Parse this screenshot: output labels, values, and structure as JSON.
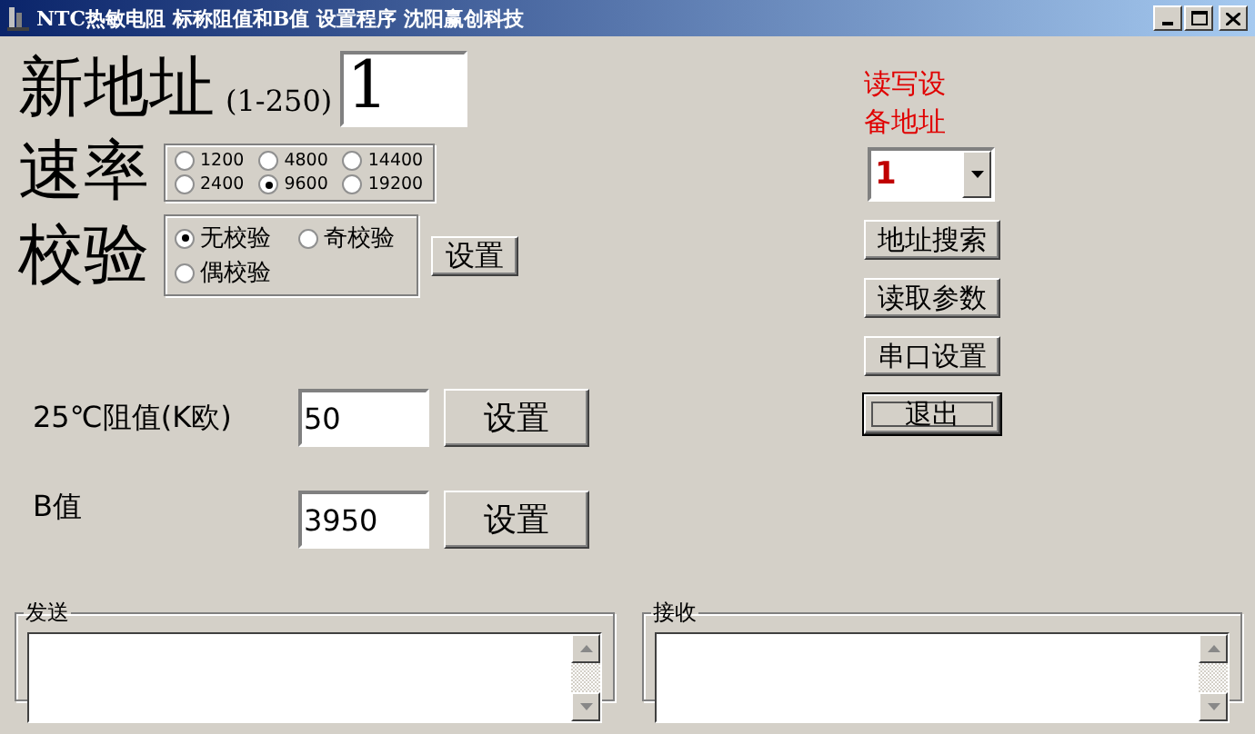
{
  "window": {
    "title": "NTC热敏电阻 标称阻值和B值 设置程序 沈阳赢创科技"
  },
  "address": {
    "label": "新地址",
    "range": "(1-250)",
    "value": "1"
  },
  "baud_rate": {
    "label": "速率",
    "options": [
      {
        "label": "1200",
        "selected": false
      },
      {
        "label": "4800",
        "selected": false
      },
      {
        "label": "14400",
        "selected": false
      },
      {
        "label": "2400",
        "selected": false
      },
      {
        "label": "9600",
        "selected": true
      },
      {
        "label": "19200",
        "selected": false
      }
    ]
  },
  "parity": {
    "label": "校验",
    "options": [
      {
        "label": "无校验",
        "selected": true
      },
      {
        "label": "奇校验",
        "selected": false
      },
      {
        "label": "偶校验",
        "selected": false
      }
    ],
    "button": "设置"
  },
  "device_address": {
    "label": "读写设备地址",
    "value": "1"
  },
  "side_buttons": [
    {
      "label": "地址搜索",
      "focused": false
    },
    {
      "label": "读取参数",
      "focused": false
    },
    {
      "label": "串口设置",
      "focused": false
    },
    {
      "label": "退出",
      "focused": true
    }
  ],
  "resistance": {
    "label": "25℃阻值(K欧)",
    "value": "50",
    "button": "设置"
  },
  "b_value": {
    "label": "B值",
    "value": "3950",
    "button": "设置"
  },
  "send": {
    "label": "发送"
  },
  "receive": {
    "label": "接收"
  }
}
